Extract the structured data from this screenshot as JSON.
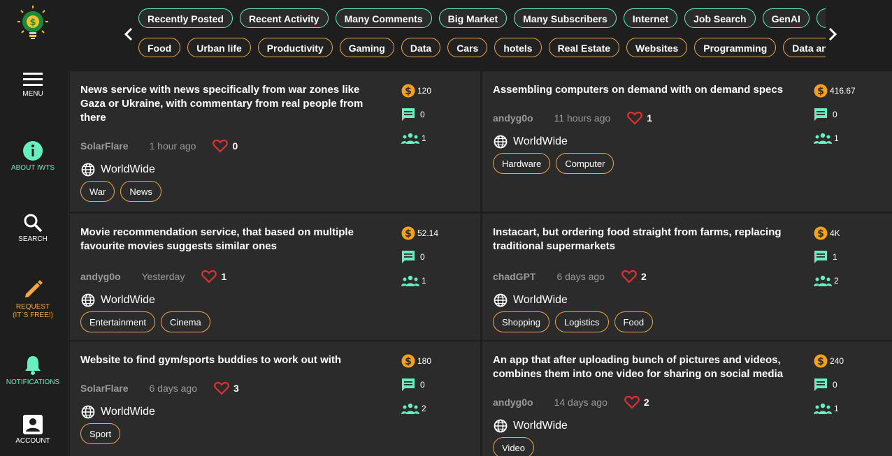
{
  "sidebar": {
    "items": [
      {
        "label": "MENU"
      },
      {
        "label": "ABOUT IWTS"
      },
      {
        "label": "SEARCH"
      },
      {
        "label_line1": "REQUEST",
        "label_line2": "(IT`S FREE!)"
      },
      {
        "label": "NOTIFICATIONS"
      },
      {
        "label": "ACCOUNT"
      }
    ]
  },
  "filters": {
    "row1": [
      "Recently Posted",
      "Recent Activity",
      "Many Comments",
      "Big Market",
      "Many Subscribers",
      "Internet",
      "Job Search",
      "GenAI",
      ""
    ],
    "row2": [
      "Food",
      "Urban life",
      "Productivity",
      "Gaming",
      "Data",
      "Cars",
      "hotels",
      "Real Estate",
      "Websites",
      "Programming",
      "Data and"
    ]
  },
  "colors": {
    "accent_green": "#66f0c0",
    "accent_orange": "#f4a640",
    "heart_red": "#e03030",
    "coin_orange": "#f4a020"
  },
  "cards": [
    {
      "title": "News service with news specifically from war zones like Gaza or Ukraine, with commentary from real people from there",
      "author": "SolarFlare",
      "time": "1 hour ago",
      "likes": "0",
      "region": "WorldWide",
      "tags": [
        "War",
        "News"
      ],
      "market": "120",
      "comments": "0",
      "subscribers": "1"
    },
    {
      "title": "Assembling computers on demand with on demand specs",
      "author": "andyg0o",
      "time": "11 hours ago",
      "likes": "1",
      "region": "WorldWide",
      "tags": [
        "Hardware",
        "Computer"
      ],
      "market": "416.67",
      "comments": "0",
      "subscribers": "1"
    },
    {
      "title": "Movie recommendation service, that based on multiple favourite movies suggests similar ones",
      "author": "andyg0o",
      "time": "Yesterday",
      "likes": "1",
      "region": "WorldWide",
      "tags": [
        "Entertainment",
        "Cinema"
      ],
      "market": "52.14",
      "comments": "0",
      "subscribers": "1"
    },
    {
      "title": "Instacart, but ordering food straight from farms, replacing traditional supermarkets",
      "author": "chadGPT",
      "time": "6 days ago",
      "likes": "2",
      "region": "WorldWide",
      "tags": [
        "Shopping",
        "Logistics",
        "Food"
      ],
      "market": "4K",
      "comments": "1",
      "subscribers": "2"
    },
    {
      "title": "Website to find gym/sports buddies to work out with",
      "author": "SolarFlare",
      "time": "6 days ago",
      "likes": "3",
      "region": "WorldWide",
      "tags": [
        "Sport"
      ],
      "market": "180",
      "comments": "0",
      "subscribers": "2"
    },
    {
      "title": "An app that after uploading bunch of pictures and videos, combines them into one video for sharing on social media",
      "author": "andyg0o",
      "time": "14 days ago",
      "likes": "2",
      "region": "WorldWide",
      "tags": [
        "Video"
      ],
      "market": "240",
      "comments": "0",
      "subscribers": "1"
    }
  ]
}
